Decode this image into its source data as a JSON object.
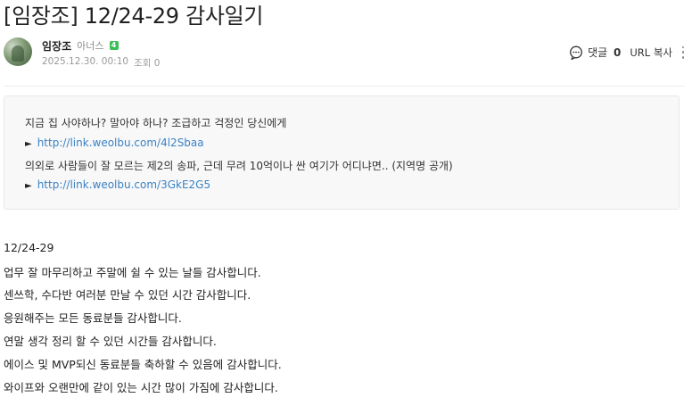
{
  "post": {
    "title": "[임장조] 12/24-29 감사일기",
    "author": "임장조",
    "grade": "아너스",
    "grade_badge": "4",
    "date": "2025.12.30. 00:10",
    "views": "조회 0"
  },
  "actions": {
    "comment_label": "댓글",
    "comment_count": "0",
    "url_copy": "URL 복사"
  },
  "link_box": {
    "line1": "지금 집 사야하나? 말아야 하나? 조급하고 걱정인 당신에게",
    "arrow": "►",
    "link1": "http://link.weolbu.com/4l2Sbaa",
    "line2": "의외로 사람들이 잘 모르는 제2의 송파, 근데 무려 10억이나 싼 여기가 어디냐면.. (지역명 공개)",
    "link2": "http://link.weolbu.com/3GkE2G5"
  },
  "body": {
    "date_line": "12/24-29",
    "lines": [
      "업무 잘 마무리하고 주말에 쉴 수 있는 날들 감사합니다.",
      "센쓰학, 수다반 여러분 만날 수 있던 시간 감사합니다.",
      "응원해주는 모든 동료분들 감사합니다.",
      "연말 생각 정리 할 수 있던 시간들 감사합니다.",
      "에이스 및 MVP되신 동료분들 축하할 수 있음에 감사합니다.",
      "와이프와 오랜만에 같이 있는 시간 많이 가짐에 감사합니다."
    ]
  }
}
